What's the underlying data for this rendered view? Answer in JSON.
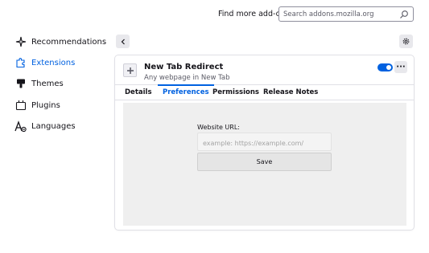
{
  "header": {
    "find_more_label": "Find more add-ons",
    "search_placeholder": "Search addons.mozilla.org"
  },
  "sidebar": {
    "items": [
      {
        "label": "Recommendations",
        "icon": "sparkle-icon",
        "active": false
      },
      {
        "label": "Extensions",
        "icon": "puzzle-icon",
        "active": true
      },
      {
        "label": "Themes",
        "icon": "paintbrush-icon",
        "active": false
      },
      {
        "label": "Plugins",
        "icon": "plugin-icon",
        "active": false
      },
      {
        "label": "Languages",
        "icon": "language-icon",
        "active": false
      }
    ]
  },
  "addon": {
    "name": "New Tab Redirect",
    "description": "Any webpage in New Tab",
    "enabled": true,
    "more_label": "···"
  },
  "tabs": [
    {
      "label": "Details",
      "active": false
    },
    {
      "label": "Preferences",
      "active": true
    },
    {
      "label": "Permissions",
      "active": false
    },
    {
      "label": "Release Notes",
      "active": false
    }
  ],
  "preferences": {
    "url_label": "Website URL:",
    "url_placeholder": "example: https://example.com/",
    "url_value": "",
    "save_label": "Save"
  },
  "colors": {
    "accent": "#0061e0",
    "panel_bg": "#efefef"
  }
}
